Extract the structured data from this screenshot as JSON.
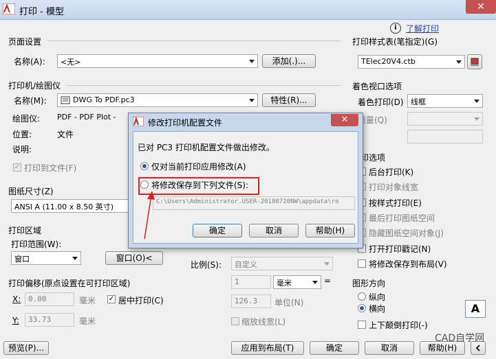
{
  "window": {
    "title": "打印 - 模型",
    "close": "✕"
  },
  "help": {
    "icon_glyph": "i",
    "link": "了解打印"
  },
  "page_setup": {
    "section": "页面设置",
    "name_label": "名称(A):",
    "name_value": "<无>",
    "add_button": "添加(.)..."
  },
  "printer": {
    "section": "打印机/绘图仪",
    "name_label": "名称(M):",
    "name_value": "DWG To PDF.pc3",
    "props_button": "特性(R)...",
    "plotter_label": "绘图仪:",
    "plotter_value": "PDF - PDF Plot -",
    "location_label": "位置:",
    "location_value": "文件",
    "desc_label": "说明:",
    "print_to_file": "打印到文件(F)"
  },
  "paper": {
    "section": "图纸尺寸(Z)",
    "value": "ANSI A (11.00 x 8.50 英寸)"
  },
  "area": {
    "section": "打印区域",
    "range_label": "打印范围(W):",
    "range_value": "窗口",
    "window_button": "窗口(O)<"
  },
  "offset": {
    "section": "打印偏移(原点设置在可打印区域)",
    "x_label": "X:",
    "x_value": "0.00",
    "x_unit": "毫米",
    "y_label": "Y:",
    "y_value": "33.73",
    "y_unit": "毫米",
    "center": "居中打印(C)"
  },
  "scale": {
    "label": "比例(S):",
    "value": "自定义",
    "v1": "1",
    "unit": "毫米",
    "eq": "=",
    "v2": "126.3",
    "unit2": "单位(N)",
    "lineweight": "缩放线宽(L)"
  },
  "style_table": {
    "section": "打印样式表(笔指定)(G)",
    "value": "TElec20V4.ctb"
  },
  "shaded": {
    "section": "着色视口选项",
    "shade_label": "着色打印(D)",
    "shade_value": "线框",
    "quality_label": "质量(Q)"
  },
  "options": {
    "section": "打印选项",
    "items": [
      "后台打印(K)",
      "打印对象线宽",
      "按样式打印(E)",
      "最后打印图纸空间",
      "隐藏图纸空间对象(J)",
      "打开打印戳记(N)",
      "将修改保存到布局(V)"
    ]
  },
  "orientation": {
    "section": "图形方向",
    "portrait": "纵向",
    "landscape": "横向",
    "upside": "上下颠倒打印(-)",
    "preview_glyph": "A"
  },
  "footer": {
    "preview": "预览(P)...",
    "apply": "应用到布局(T)",
    "ok": "确定",
    "cancel": "取消",
    "help": "帮助(H)",
    "watermark": "CAD自学网"
  },
  "modal": {
    "title": "修改打印机配置文件",
    "close": "✕",
    "message": "已对 PC3 打印机配置文件做出修改。",
    "opt1": "仅对当前打印应用修改(A)",
    "opt2": "将修改保存到下列文件(S):",
    "path": "C:\\Users\\Administrator.USER-20180720NW\\appdata\\ro",
    "ok": "确定",
    "cancel": "取消",
    "help": "帮助(H)"
  },
  "colors": {
    "accent": "#2a5fa8",
    "highlight": "#e02020"
  }
}
